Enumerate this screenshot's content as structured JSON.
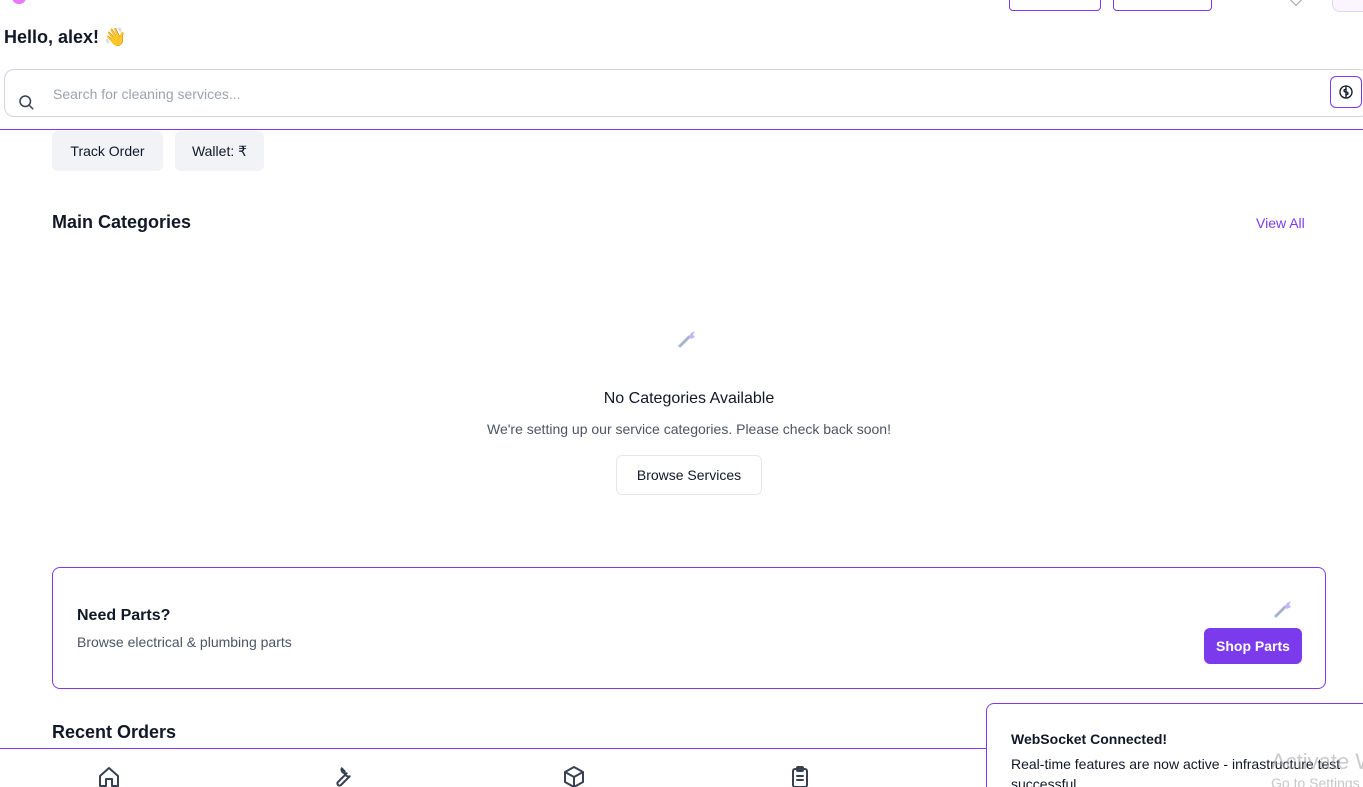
{
  "header": {
    "greeting": "Hello, alex! 👋"
  },
  "search": {
    "placeholder": "Search for cleaning services...",
    "value": "",
    "icon": "search-icon",
    "language_icon": "brain-icon"
  },
  "quick_actions": {
    "track_order": "Track Order",
    "wallet": "Wallet: ₹"
  },
  "categories": {
    "title": "Main Categories",
    "view_all": "View All",
    "empty_icon": "wrench-icon",
    "empty_title": "No Categories Available",
    "empty_subtitle": "We're setting up our service categories. Please check back soon!",
    "browse_button": "Browse Services"
  },
  "parts_promo": {
    "title": "Need Parts?",
    "subtitle": "Browse electrical & plumbing parts",
    "icon": "wrench-icon",
    "button": "Shop Parts"
  },
  "recent_orders": {
    "title": "Recent Orders"
  },
  "bottom_nav": [
    {
      "icon": "home-icon"
    },
    {
      "icon": "wrench-icon"
    },
    {
      "icon": "package-icon"
    },
    {
      "icon": "clipboard-icon"
    }
  ],
  "toast": {
    "title": "WebSocket Connected!",
    "message": "Real-time features are now active - infrastructure test successful"
  },
  "watermark": {
    "line1": "Activate W",
    "line2": "Go to Settings"
  },
  "colors": {
    "accent": "#7c3aed",
    "chip_bg": "#f1f3f7",
    "muted_text": "#4b5563"
  }
}
